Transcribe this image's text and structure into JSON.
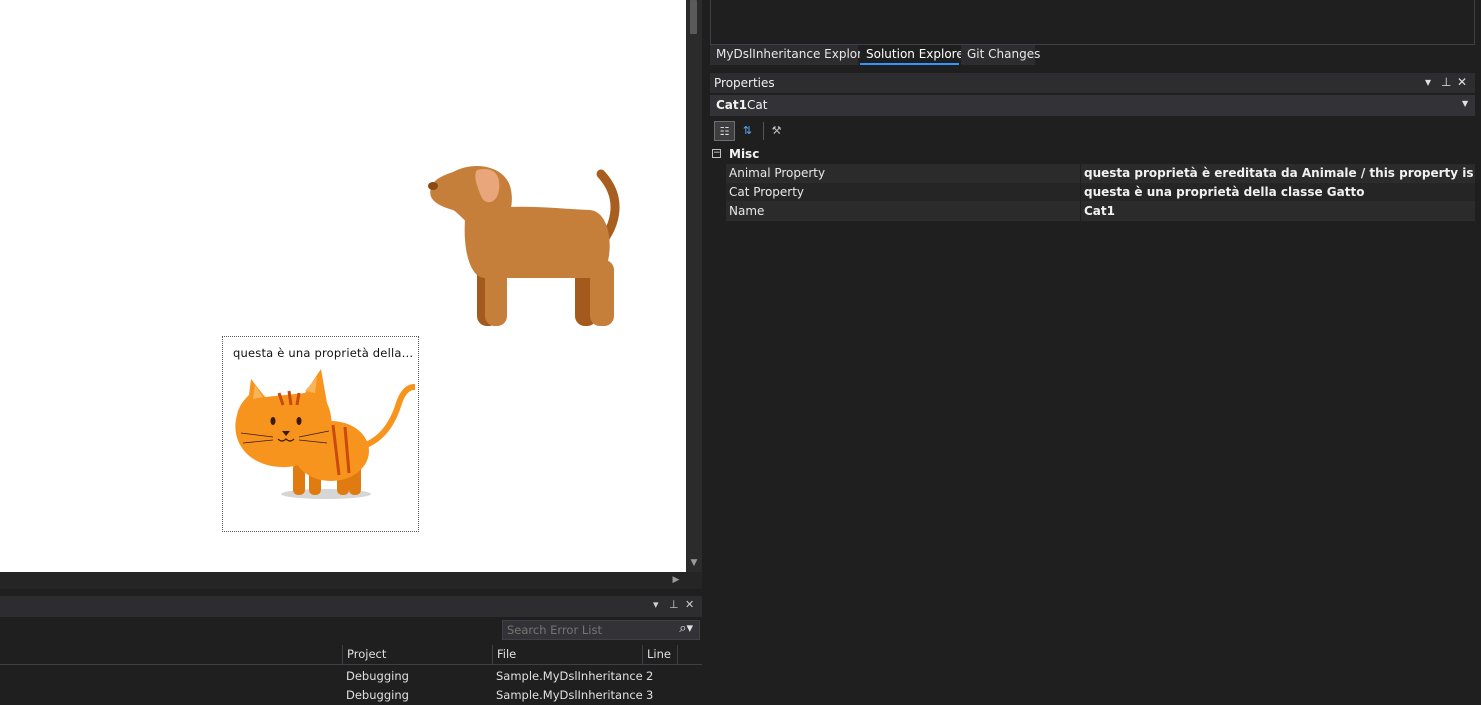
{
  "designer": {
    "cat_shape_label": "questa è una proprietà della classe Gatto"
  },
  "error_list": {
    "search_placeholder": "Search Error List",
    "columns": [
      "Project",
      "File",
      "Line"
    ],
    "rows": [
      {
        "project": "Debugging",
        "file": "Sample.MyDslInheritance",
        "line": "2"
      },
      {
        "project": "Debugging",
        "file": "Sample.MyDslInheritance",
        "line": "3"
      }
    ]
  },
  "tabs": [
    {
      "label": "MyDslInheritance Explorer",
      "active": false
    },
    {
      "label": "Solution Explorer",
      "active": true
    },
    {
      "label": "Git Changes",
      "active": false
    }
  ],
  "properties": {
    "title": "Properties",
    "selected_object": {
      "name": "Cat1",
      "type": "Cat"
    },
    "category": "Misc",
    "rows": [
      {
        "name": "Animal Property",
        "value": "questa proprietà è ereditata da Animale / this property is inherted fror"
      },
      {
        "name": "Cat Property",
        "value": "questa è una proprietà della classe Gatto"
      },
      {
        "name": "Name",
        "value": "Cat1"
      }
    ]
  },
  "icons": {
    "dropdown": "chevron-down-icon",
    "pin": "pin-icon",
    "close": "close-icon",
    "search": "search-icon",
    "categorized": "categorized-view-icon",
    "alphabetical": "alphabetical-sort-icon",
    "property_pages": "wrench-icon"
  },
  "colors": {
    "accent": "#3794ff",
    "panel_bg": "#1f1f1f",
    "canvas_bg": "#ffffff",
    "dog": "#c67f3b",
    "cat": "#f7941d"
  }
}
